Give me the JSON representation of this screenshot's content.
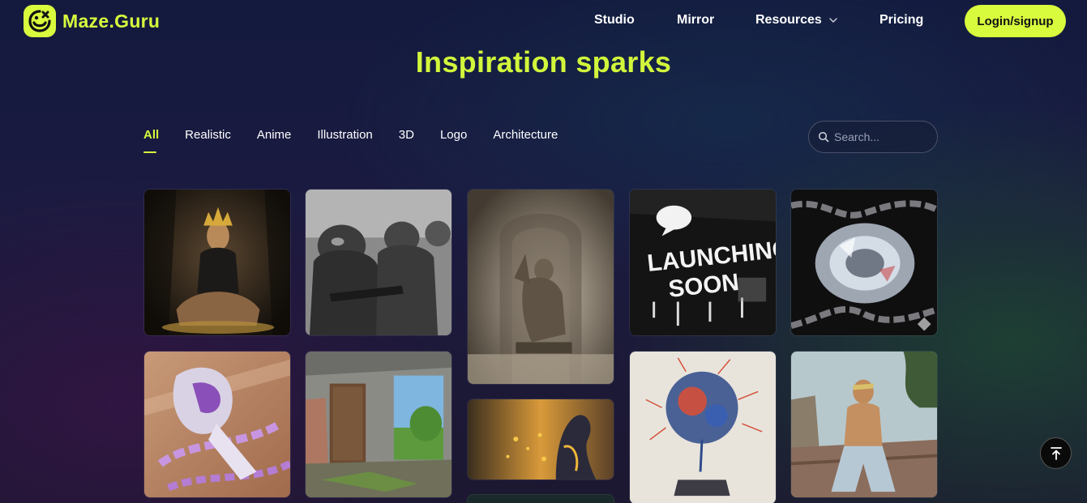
{
  "brand": {
    "name": "Maze.Guru",
    "accent": "#d8fb3d"
  },
  "nav": {
    "studio": "Studio",
    "mirror": "Mirror",
    "resources": "Resources",
    "pricing": "Pricing",
    "login": "Login/signup"
  },
  "page": {
    "title": "Inspiration sparks"
  },
  "tabs": [
    "All",
    "Realistic",
    "Anime",
    "Illustration",
    "3D",
    "Logo",
    "Architecture"
  ],
  "active_tab": "All",
  "search": {
    "placeholder": "Search...",
    "value": ""
  },
  "gallery": {
    "launching_text_1": "LAUNCHING",
    "launching_text_2": "SOON"
  },
  "icons": {
    "search": "search-icon",
    "chevron": "chevron-down-icon",
    "back_to_top": "arrow-up-to-line-icon",
    "logo": "smiley-logo-icon"
  }
}
